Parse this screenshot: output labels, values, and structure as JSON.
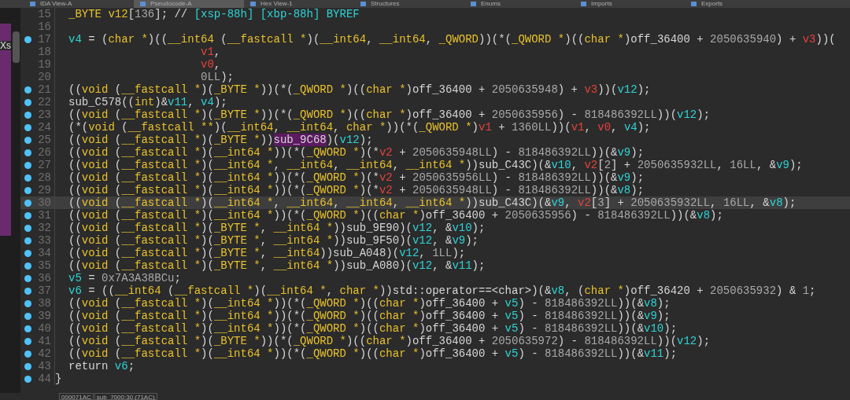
{
  "tabs": [
    {
      "label": "IDA View-A",
      "selected": false
    },
    {
      "label": "Pseudocode-A",
      "selected": true
    },
    {
      "label": "Hex View-1",
      "selected": false
    },
    {
      "label": "Structures",
      "selected": false
    },
    {
      "label": "Enums",
      "selected": false
    },
    {
      "label": "Imports",
      "selected": false
    },
    {
      "label": "Exports",
      "selected": false
    }
  ],
  "side_panel": {
    "label": "Xs"
  },
  "code_lines": [
    {
      "num": "15",
      "kind": "code",
      "breakpoint": false,
      "selected": false,
      "tokens": [
        {
          "kind": "type",
          "text": "_BYTE v12"
        },
        {
          "kind": "plain",
          "text": "["
        },
        {
          "kind": "number",
          "text": "136"
        },
        {
          "kind": "plain",
          "text": "]; //"
        },
        {
          "kind": "comment",
          "text": " [xsp-88h] [xbp-88h] BYREF"
        }
      ]
    },
    {
      "num": "16",
      "breakpoint": false,
      "selected": false
    },
    {
      "num": "17",
      "kind": "code",
      "breakpoint": true,
      "selected": false,
      "tokens": [
        {
          "kind": "var",
          "text": "v4"
        },
        {
          "kind": "plain",
          "text": " = ("
        },
        {
          "kind": "type",
          "text": "char *"
        },
        {
          "kind": "plain",
          "text": ")(("
        },
        {
          "kind": "type",
          "text": "__int64"
        },
        {
          "kind": "plain",
          "text": " ("
        },
        {
          "kind": "type",
          "text": "__fastcall *"
        },
        {
          "kind": "plain",
          "text": ")("
        },
        {
          "kind": "type",
          "text": "__int64"
        },
        {
          "kind": "plain",
          "text": ", "
        },
        {
          "kind": "type",
          "text": "__int64"
        },
        {
          "kind": "plain",
          "text": ", "
        },
        {
          "kind": "type",
          "text": "_QWORD"
        },
        {
          "kind": "plain",
          "text": "))(*("
        },
        {
          "kind": "type",
          "text": "_QWORD *"
        },
        {
          "kind": "plain",
          "text": ")(("
        },
        {
          "kind": "type",
          "text": "char *"
        },
        {
          "kind": "plain",
          "text": ")off_36400 + "
        },
        {
          "kind": "number",
          "text": "2050635940"
        },
        {
          "kind": "plain",
          "text": ") + "
        },
        {
          "kind": "arg",
          "text": "v3"
        },
        {
          "kind": "plain",
          "text": "))("
        }
      ]
    },
    {
      "num": "18",
      "kind": "continuation",
      "breakpoint": false,
      "selected": false,
      "tokens": [
        {
          "kind": "arg",
          "text": "v1"
        },
        {
          "kind": "plain",
          "text": ","
        }
      ]
    },
    {
      "num": "19",
      "kind": "continuation",
      "breakpoint": false,
      "selected": false,
      "tokens": [
        {
          "kind": "arg",
          "text": "v0"
        },
        {
          "kind": "plain",
          "text": ","
        }
      ]
    },
    {
      "num": "20",
      "kind": "continuation",
      "breakpoint": false,
      "selected": false,
      "tokens": [
        {
          "kind": "number",
          "text": "0LL"
        },
        {
          "kind": "plain",
          "text": ");"
        }
      ]
    },
    {
      "num": "21",
      "kind": "code",
      "breakpoint": true,
      "selected": false,
      "tokens": [
        {
          "kind": "plain",
          "text": "(("
        },
        {
          "kind": "type",
          "text": "void"
        },
        {
          "kind": "plain",
          "text": " ("
        },
        {
          "kind": "type",
          "text": "__fastcall *"
        },
        {
          "kind": "plain",
          "text": ")("
        },
        {
          "kind": "type",
          "text": "_BYTE *"
        },
        {
          "kind": "plain",
          "text": "))(*("
        },
        {
          "kind": "type",
          "text": "_QWORD *"
        },
        {
          "kind": "plain",
          "text": ")(("
        },
        {
          "kind": "type",
          "text": "char *"
        },
        {
          "kind": "plain",
          "text": ")off_36400 + "
        },
        {
          "kind": "number",
          "text": "2050635948"
        },
        {
          "kind": "plain",
          "text": ") + "
        },
        {
          "kind": "arg",
          "text": "v3"
        },
        {
          "kind": "plain",
          "text": "))("
        },
        {
          "kind": "var",
          "text": "v12"
        },
        {
          "kind": "plain",
          "text": ");"
        }
      ]
    },
    {
      "num": "22",
      "kind": "code",
      "breakpoint": true,
      "selected": false,
      "tokens": [
        {
          "kind": "plain",
          "text": "sub_C578(("
        },
        {
          "kind": "type",
          "text": "int"
        },
        {
          "kind": "plain",
          "text": ")&"
        },
        {
          "kind": "var",
          "text": "v11"
        },
        {
          "kind": "plain",
          "text": ", "
        },
        {
          "kind": "var",
          "text": "v4"
        },
        {
          "kind": "plain",
          "text": ");"
        }
      ]
    },
    {
      "num": "23",
      "kind": "code",
      "breakpoint": true,
      "selected": false,
      "tokens": [
        {
          "kind": "plain",
          "text": "(("
        },
        {
          "kind": "type",
          "text": "void"
        },
        {
          "kind": "plain",
          "text": " ("
        },
        {
          "kind": "type",
          "text": "__fastcall *"
        },
        {
          "kind": "plain",
          "text": ")("
        },
        {
          "kind": "type",
          "text": "_BYTE *"
        },
        {
          "kind": "plain",
          "text": "))(*("
        },
        {
          "kind": "type",
          "text": "_QWORD *"
        },
        {
          "kind": "plain",
          "text": ")(("
        },
        {
          "kind": "type",
          "text": "char *"
        },
        {
          "kind": "plain",
          "text": ")off_36400 + "
        },
        {
          "kind": "number",
          "text": "2050635956"
        },
        {
          "kind": "plain",
          "text": ") - "
        },
        {
          "kind": "number",
          "text": "818486392LL"
        },
        {
          "kind": "plain",
          "text": "))("
        },
        {
          "kind": "var",
          "text": "v12"
        },
        {
          "kind": "plain",
          "text": ");"
        }
      ]
    },
    {
      "num": "24",
      "kind": "code",
      "breakpoint": true,
      "selected": false,
      "tokens": [
        {
          "kind": "plain",
          "text": "(*("
        },
        {
          "kind": "type",
          "text": "void"
        },
        {
          "kind": "plain",
          "text": " ("
        },
        {
          "kind": "type",
          "text": "__fastcall **"
        },
        {
          "kind": "plain",
          "text": ")("
        },
        {
          "kind": "type",
          "text": "__int64"
        },
        {
          "kind": "plain",
          "text": ", "
        },
        {
          "kind": "type",
          "text": "__int64"
        },
        {
          "kind": "plain",
          "text": ", "
        },
        {
          "kind": "type",
          "text": "char *"
        },
        {
          "kind": "plain",
          "text": "))(*("
        },
        {
          "kind": "type",
          "text": "_QWORD *"
        },
        {
          "kind": "plain",
          "text": ")"
        },
        {
          "kind": "arg",
          "text": "v1"
        },
        {
          "kind": "plain",
          "text": " + "
        },
        {
          "kind": "number",
          "text": "1360LL"
        },
        {
          "kind": "plain",
          "text": "))("
        },
        {
          "kind": "arg",
          "text": "v1"
        },
        {
          "kind": "plain",
          "text": ", "
        },
        {
          "kind": "arg",
          "text": "v0"
        },
        {
          "kind": "plain",
          "text": ", "
        },
        {
          "kind": "var",
          "text": "v4"
        },
        {
          "kind": "plain",
          "text": ");"
        }
      ]
    },
    {
      "num": "25",
      "kind": "code",
      "breakpoint": true,
      "selected": false,
      "tokens": [
        {
          "kind": "plain",
          "text": "(("
        },
        {
          "kind": "type",
          "text": "void"
        },
        {
          "kind": "plain",
          "text": " ("
        },
        {
          "kind": "type",
          "text": "__fastcall *"
        },
        {
          "kind": "plain",
          "text": ")("
        },
        {
          "kind": "type",
          "text": "_BYTE *"
        },
        {
          "kind": "plain",
          "text": "))"
        },
        {
          "kind": "highlight",
          "text": "sub_9C68"
        },
        {
          "kind": "plain",
          "text": ")("
        },
        {
          "kind": "var",
          "text": "v12"
        },
        {
          "kind": "plain",
          "text": ");"
        }
      ]
    },
    {
      "num": "26",
      "kind": "code",
      "breakpoint": true,
      "selected": false,
      "tokens": [
        {
          "kind": "plain",
          "text": "(("
        },
        {
          "kind": "type",
          "text": "void"
        },
        {
          "kind": "plain",
          "text": " ("
        },
        {
          "kind": "type",
          "text": "__fastcall *"
        },
        {
          "kind": "plain",
          "text": ")("
        },
        {
          "kind": "type",
          "text": "__int64 *"
        },
        {
          "kind": "plain",
          "text": "))(*("
        },
        {
          "kind": "type",
          "text": "_QWORD *"
        },
        {
          "kind": "plain",
          "text": ")(*"
        },
        {
          "kind": "arg",
          "text": "v2"
        },
        {
          "kind": "plain",
          "text": " + "
        },
        {
          "kind": "number",
          "text": "2050635948LL"
        },
        {
          "kind": "plain",
          "text": ") - "
        },
        {
          "kind": "number",
          "text": "818486392LL"
        },
        {
          "kind": "plain",
          "text": "))(&"
        },
        {
          "kind": "var",
          "text": "v9"
        },
        {
          "kind": "plain",
          "text": ");"
        }
      ]
    },
    {
      "num": "27",
      "kind": "code",
      "breakpoint": true,
      "selected": false,
      "tokens": [
        {
          "kind": "plain",
          "text": "(("
        },
        {
          "kind": "type",
          "text": "void"
        },
        {
          "kind": "plain",
          "text": " ("
        },
        {
          "kind": "type",
          "text": "__fastcall *"
        },
        {
          "kind": "plain",
          "text": ")("
        },
        {
          "kind": "type",
          "text": "__int64 *"
        },
        {
          "kind": "plain",
          "text": ", "
        },
        {
          "kind": "type",
          "text": "__int64"
        },
        {
          "kind": "plain",
          "text": ", "
        },
        {
          "kind": "type",
          "text": "__int64"
        },
        {
          "kind": "plain",
          "text": ", "
        },
        {
          "kind": "type",
          "text": "__int64 *"
        },
        {
          "kind": "plain",
          "text": "))sub_C43C)(&"
        },
        {
          "kind": "var",
          "text": "v10"
        },
        {
          "kind": "plain",
          "text": ", "
        },
        {
          "kind": "arg",
          "text": "v2"
        },
        {
          "kind": "plain",
          "text": "["
        },
        {
          "kind": "number",
          "text": "2"
        },
        {
          "kind": "plain",
          "text": "] + "
        },
        {
          "kind": "number",
          "text": "2050635932LL"
        },
        {
          "kind": "plain",
          "text": ", "
        },
        {
          "kind": "number",
          "text": "16LL"
        },
        {
          "kind": "plain",
          "text": ", &"
        },
        {
          "kind": "var",
          "text": "v9"
        },
        {
          "kind": "plain",
          "text": ");"
        }
      ]
    },
    {
      "num": "28",
      "kind": "code",
      "breakpoint": true,
      "selected": false,
      "tokens": [
        {
          "kind": "plain",
          "text": "(("
        },
        {
          "kind": "type",
          "text": "void"
        },
        {
          "kind": "plain",
          "text": " ("
        },
        {
          "kind": "type",
          "text": "__fastcall *"
        },
        {
          "kind": "plain",
          "text": ")("
        },
        {
          "kind": "type",
          "text": "__int64 *"
        },
        {
          "kind": "plain",
          "text": "))(*("
        },
        {
          "kind": "type",
          "text": "_QWORD *"
        },
        {
          "kind": "plain",
          "text": ")(*"
        },
        {
          "kind": "arg",
          "text": "v2"
        },
        {
          "kind": "plain",
          "text": " + "
        },
        {
          "kind": "number",
          "text": "2050635956LL"
        },
        {
          "kind": "plain",
          "text": ") - "
        },
        {
          "kind": "number",
          "text": "818486392LL"
        },
        {
          "kind": "plain",
          "text": "))(&"
        },
        {
          "kind": "var",
          "text": "v9"
        },
        {
          "kind": "plain",
          "text": ");"
        }
      ]
    },
    {
      "num": "29",
      "kind": "code",
      "breakpoint": true,
      "selected": false,
      "tokens": [
        {
          "kind": "plain",
          "text": "(("
        },
        {
          "kind": "type",
          "text": "void"
        },
        {
          "kind": "plain",
          "text": " ("
        },
        {
          "kind": "type",
          "text": "__fastcall *"
        },
        {
          "kind": "plain",
          "text": ")("
        },
        {
          "kind": "type",
          "text": "__int64 *"
        },
        {
          "kind": "plain",
          "text": "))(*("
        },
        {
          "kind": "type",
          "text": "_QWORD *"
        },
        {
          "kind": "plain",
          "text": ")(*"
        },
        {
          "kind": "arg",
          "text": "v2"
        },
        {
          "kind": "plain",
          "text": " + "
        },
        {
          "kind": "number",
          "text": "2050635948LL"
        },
        {
          "kind": "plain",
          "text": ") - "
        },
        {
          "kind": "number",
          "text": "818486392LL"
        },
        {
          "kind": "plain",
          "text": "))(&"
        },
        {
          "kind": "var",
          "text": "v8"
        },
        {
          "kind": "plain",
          "text": ");"
        }
      ]
    },
    {
      "num": "30",
      "kind": "code",
      "breakpoint": true,
      "selected": true,
      "tokens": [
        {
          "kind": "plain",
          "text": "(("
        },
        {
          "kind": "type",
          "text": "void"
        },
        {
          "kind": "plain",
          "text": " ("
        },
        {
          "kind": "type",
          "text": "__fastcall *"
        },
        {
          "kind": "plain",
          "text": ")("
        },
        {
          "kind": "type",
          "text": "__int64 *"
        },
        {
          "kind": "plain",
          "text": ", "
        },
        {
          "kind": "type",
          "text": "__int64"
        },
        {
          "kind": "plain",
          "text": ", "
        },
        {
          "kind": "type",
          "text": "__int64"
        },
        {
          "kind": "plain",
          "text": ", "
        },
        {
          "kind": "type",
          "text": "__int64 *"
        },
        {
          "kind": "plain",
          "text": "))sub_C43C)(&"
        },
        {
          "kind": "var",
          "text": "v9"
        },
        {
          "kind": "plain",
          "text": ", "
        },
        {
          "kind": "arg",
          "text": "v2"
        },
        {
          "kind": "plain",
          "text": "["
        },
        {
          "kind": "number",
          "text": "3"
        },
        {
          "kind": "plain",
          "text": "] + "
        },
        {
          "kind": "number",
          "text": "2050635932LL"
        },
        {
          "kind": "plain",
          "text": ", "
        },
        {
          "kind": "number",
          "text": "16LL"
        },
        {
          "kind": "plain",
          "text": ", &"
        },
        {
          "kind": "var",
          "text": "v8"
        },
        {
          "kind": "plain",
          "text": ");"
        }
      ]
    },
    {
      "num": "31",
      "kind": "code",
      "breakpoint": true,
      "selected": false,
      "tokens": [
        {
          "kind": "plain",
          "text": "(("
        },
        {
          "kind": "type",
          "text": "void"
        },
        {
          "kind": "plain",
          "text": " ("
        },
        {
          "kind": "type",
          "text": "__fastcall *"
        },
        {
          "kind": "plain",
          "text": ")("
        },
        {
          "kind": "type",
          "text": "__int64 *"
        },
        {
          "kind": "plain",
          "text": "))(*("
        },
        {
          "kind": "type",
          "text": "_QWORD *"
        },
        {
          "kind": "plain",
          "text": ")(("
        },
        {
          "kind": "type",
          "text": "char *"
        },
        {
          "kind": "plain",
          "text": ")off_36400 + "
        },
        {
          "kind": "number",
          "text": "2050635956"
        },
        {
          "kind": "plain",
          "text": ") - "
        },
        {
          "kind": "number",
          "text": "818486392LL"
        },
        {
          "kind": "plain",
          "text": "))(&"
        },
        {
          "kind": "var",
          "text": "v8"
        },
        {
          "kind": "plain",
          "text": ");"
        }
      ]
    },
    {
      "num": "32",
      "kind": "code",
      "breakpoint": true,
      "selected": false,
      "tokens": [
        {
          "kind": "plain",
          "text": "(("
        },
        {
          "kind": "type",
          "text": "void"
        },
        {
          "kind": "plain",
          "text": " ("
        },
        {
          "kind": "type",
          "text": "__fastcall *"
        },
        {
          "kind": "plain",
          "text": ")("
        },
        {
          "kind": "type",
          "text": "_BYTE *"
        },
        {
          "kind": "plain",
          "text": ", "
        },
        {
          "kind": "type",
          "text": "__int64 *"
        },
        {
          "kind": "plain",
          "text": "))sub_9E90)("
        },
        {
          "kind": "var",
          "text": "v12"
        },
        {
          "kind": "plain",
          "text": ", &"
        },
        {
          "kind": "var",
          "text": "v10"
        },
        {
          "kind": "plain",
          "text": ");"
        }
      ]
    },
    {
      "num": "33",
      "kind": "code",
      "breakpoint": true,
      "selected": false,
      "tokens": [
        {
          "kind": "plain",
          "text": "(("
        },
        {
          "kind": "type",
          "text": "void"
        },
        {
          "kind": "plain",
          "text": " ("
        },
        {
          "kind": "type",
          "text": "__fastcall *"
        },
        {
          "kind": "plain",
          "text": ")("
        },
        {
          "kind": "type",
          "text": "_BYTE *"
        },
        {
          "kind": "plain",
          "text": ", "
        },
        {
          "kind": "type",
          "text": "__int64 *"
        },
        {
          "kind": "plain",
          "text": "))sub_9F50)("
        },
        {
          "kind": "var",
          "text": "v12"
        },
        {
          "kind": "plain",
          "text": ", &"
        },
        {
          "kind": "var",
          "text": "v9"
        },
        {
          "kind": "plain",
          "text": ");"
        }
      ]
    },
    {
      "num": "34",
      "kind": "code",
      "breakpoint": true,
      "selected": false,
      "tokens": [
        {
          "kind": "plain",
          "text": "(("
        },
        {
          "kind": "type",
          "text": "void"
        },
        {
          "kind": "plain",
          "text": " ("
        },
        {
          "kind": "type",
          "text": "__fastcall *"
        },
        {
          "kind": "plain",
          "text": ")("
        },
        {
          "kind": "type",
          "text": "_BYTE *"
        },
        {
          "kind": "plain",
          "text": ", "
        },
        {
          "kind": "type",
          "text": "__int64"
        },
        {
          "kind": "plain",
          "text": "))sub_A048)("
        },
        {
          "kind": "var",
          "text": "v12"
        },
        {
          "kind": "plain",
          "text": ", "
        },
        {
          "kind": "number",
          "text": "1LL"
        },
        {
          "kind": "plain",
          "text": ");"
        }
      ]
    },
    {
      "num": "35",
      "kind": "code",
      "breakpoint": true,
      "selected": false,
      "tokens": [
        {
          "kind": "plain",
          "text": "(("
        },
        {
          "kind": "type",
          "text": "void"
        },
        {
          "kind": "plain",
          "text": " ("
        },
        {
          "kind": "type",
          "text": "__fastcall *"
        },
        {
          "kind": "plain",
          "text": ")("
        },
        {
          "kind": "type",
          "text": "_BYTE *"
        },
        {
          "kind": "plain",
          "text": ", "
        },
        {
          "kind": "type",
          "text": "__int64 *"
        },
        {
          "kind": "plain",
          "text": "))sub_A080)("
        },
        {
          "kind": "var",
          "text": "v12"
        },
        {
          "kind": "plain",
          "text": ", &"
        },
        {
          "kind": "var",
          "text": "v11"
        },
        {
          "kind": "plain",
          "text": ");"
        }
      ]
    },
    {
      "num": "36",
      "kind": "code",
      "breakpoint": true,
      "selected": false,
      "tokens": [
        {
          "kind": "var",
          "text": "v5"
        },
        {
          "kind": "plain",
          "text": " = "
        },
        {
          "kind": "number",
          "text": "0x7A3A38BCu"
        },
        {
          "kind": "plain",
          "text": ";"
        }
      ]
    },
    {
      "num": "37",
      "kind": "code",
      "breakpoint": true,
      "selected": false,
      "tokens": [
        {
          "kind": "var",
          "text": "v6"
        },
        {
          "kind": "plain",
          "text": " = (("
        },
        {
          "kind": "type",
          "text": "__int64"
        },
        {
          "kind": "plain",
          "text": " ("
        },
        {
          "kind": "type",
          "text": "__fastcall *"
        },
        {
          "kind": "plain",
          "text": ")("
        },
        {
          "kind": "type",
          "text": "__int64 *"
        },
        {
          "kind": "plain",
          "text": ", "
        },
        {
          "kind": "type",
          "text": "char *"
        },
        {
          "kind": "plain",
          "text": "))std::operator==<char>)(&"
        },
        {
          "kind": "var",
          "text": "v8"
        },
        {
          "kind": "plain",
          "text": ", ("
        },
        {
          "kind": "type",
          "text": "char *"
        },
        {
          "kind": "plain",
          "text": ")off_36420 + "
        },
        {
          "kind": "number",
          "text": "2050635932"
        },
        {
          "kind": "plain",
          "text": ") & "
        },
        {
          "kind": "number",
          "text": "1"
        },
        {
          "kind": "plain",
          "text": ";"
        }
      ]
    },
    {
      "num": "38",
      "kind": "code",
      "breakpoint": true,
      "selected": false,
      "tokens": [
        {
          "kind": "plain",
          "text": "(("
        },
        {
          "kind": "type",
          "text": "void"
        },
        {
          "kind": "plain",
          "text": " ("
        },
        {
          "kind": "type",
          "text": "__fastcall *"
        },
        {
          "kind": "plain",
          "text": ")("
        },
        {
          "kind": "type",
          "text": "__int64 *"
        },
        {
          "kind": "plain",
          "text": "))(*("
        },
        {
          "kind": "type",
          "text": "_QWORD *"
        },
        {
          "kind": "plain",
          "text": ")(("
        },
        {
          "kind": "type",
          "text": "char *"
        },
        {
          "kind": "plain",
          "text": ")off_36400 + "
        },
        {
          "kind": "var",
          "text": "v5"
        },
        {
          "kind": "plain",
          "text": ") - "
        },
        {
          "kind": "number",
          "text": "818486392LL"
        },
        {
          "kind": "plain",
          "text": "))(&"
        },
        {
          "kind": "var",
          "text": "v8"
        },
        {
          "kind": "plain",
          "text": ");"
        }
      ]
    },
    {
      "num": "39",
      "kind": "code",
      "breakpoint": true,
      "selected": false,
      "tokens": [
        {
          "kind": "plain",
          "text": "(("
        },
        {
          "kind": "type",
          "text": "void"
        },
        {
          "kind": "plain",
          "text": " ("
        },
        {
          "kind": "type",
          "text": "__fastcall *"
        },
        {
          "kind": "plain",
          "text": ")("
        },
        {
          "kind": "type",
          "text": "__int64 *"
        },
        {
          "kind": "plain",
          "text": "))(*("
        },
        {
          "kind": "type",
          "text": "_QWORD *"
        },
        {
          "kind": "plain",
          "text": ")(("
        },
        {
          "kind": "type",
          "text": "char *"
        },
        {
          "kind": "plain",
          "text": ")off_36400 + "
        },
        {
          "kind": "var",
          "text": "v5"
        },
        {
          "kind": "plain",
          "text": ") - "
        },
        {
          "kind": "number",
          "text": "818486392LL"
        },
        {
          "kind": "plain",
          "text": "))(&"
        },
        {
          "kind": "var",
          "text": "v9"
        },
        {
          "kind": "plain",
          "text": ");"
        }
      ]
    },
    {
      "num": "40",
      "kind": "code",
      "breakpoint": true,
      "selected": false,
      "tokens": [
        {
          "kind": "plain",
          "text": "(("
        },
        {
          "kind": "type",
          "text": "void"
        },
        {
          "kind": "plain",
          "text": " ("
        },
        {
          "kind": "type",
          "text": "__fastcall *"
        },
        {
          "kind": "plain",
          "text": ")("
        },
        {
          "kind": "type",
          "text": "__int64 *"
        },
        {
          "kind": "plain",
          "text": "))(*("
        },
        {
          "kind": "type",
          "text": "_QWORD *"
        },
        {
          "kind": "plain",
          "text": ")(("
        },
        {
          "kind": "type",
          "text": "char *"
        },
        {
          "kind": "plain",
          "text": ")off_36400 + "
        },
        {
          "kind": "var",
          "text": "v5"
        },
        {
          "kind": "plain",
          "text": ") - "
        },
        {
          "kind": "number",
          "text": "818486392LL"
        },
        {
          "kind": "plain",
          "text": "))(&"
        },
        {
          "kind": "var",
          "text": "v10"
        },
        {
          "kind": "plain",
          "text": ");"
        }
      ]
    },
    {
      "num": "41",
      "kind": "code",
      "breakpoint": true,
      "selected": false,
      "tokens": [
        {
          "kind": "plain",
          "text": "(("
        },
        {
          "kind": "type",
          "text": "void"
        },
        {
          "kind": "plain",
          "text": " ("
        },
        {
          "kind": "type",
          "text": "__fastcall *"
        },
        {
          "kind": "plain",
          "text": ")("
        },
        {
          "kind": "type",
          "text": "_BYTE *"
        },
        {
          "kind": "plain",
          "text": "))(*("
        },
        {
          "kind": "type",
          "text": "_QWORD *"
        },
        {
          "kind": "plain",
          "text": ")(("
        },
        {
          "kind": "type",
          "text": "char *"
        },
        {
          "kind": "plain",
          "text": ")off_36400 + "
        },
        {
          "kind": "number",
          "text": "2050635972"
        },
        {
          "kind": "plain",
          "text": ") - "
        },
        {
          "kind": "number",
          "text": "818486392LL"
        },
        {
          "kind": "plain",
          "text": "))("
        },
        {
          "kind": "var",
          "text": "v12"
        },
        {
          "kind": "plain",
          "text": ");"
        }
      ]
    },
    {
      "num": "42",
      "kind": "code",
      "breakpoint": true,
      "selected": false,
      "tokens": [
        {
          "kind": "plain",
          "text": "(("
        },
        {
          "kind": "type",
          "text": "void"
        },
        {
          "kind": "plain",
          "text": " ("
        },
        {
          "kind": "type",
          "text": "__fastcall *"
        },
        {
          "kind": "plain",
          "text": ")("
        },
        {
          "kind": "type",
          "text": "__int64 *"
        },
        {
          "kind": "plain",
          "text": "))(*("
        },
        {
          "kind": "type",
          "text": "_QWORD *"
        },
        {
          "kind": "plain",
          "text": ")(("
        },
        {
          "kind": "type",
          "text": "char *"
        },
        {
          "kind": "plain",
          "text": ")off_36400 + "
        },
        {
          "kind": "var",
          "text": "v5"
        },
        {
          "kind": "plain",
          "text": ") - "
        },
        {
          "kind": "number",
          "text": "818486392LL"
        },
        {
          "kind": "plain",
          "text": "))(&"
        },
        {
          "kind": "var",
          "text": "v11"
        },
        {
          "kind": "plain",
          "text": ");"
        }
      ]
    },
    {
      "num": "43",
      "kind": "code",
      "breakpoint": true,
      "selected": false,
      "tokens": [
        {
          "kind": "plain",
          "text": "return "
        },
        {
          "kind": "var",
          "text": "v6"
        },
        {
          "kind": "plain",
          "text": ";"
        }
      ]
    },
    {
      "num": "44",
      "kind": "brace",
      "breakpoint": true,
      "selected": false,
      "tokens": [
        {
          "kind": "plain",
          "text": "}"
        }
      ]
    }
  ],
  "status_bar": {
    "address": "000071AC",
    "location": "sub_7000:30 (71AC)"
  }
}
